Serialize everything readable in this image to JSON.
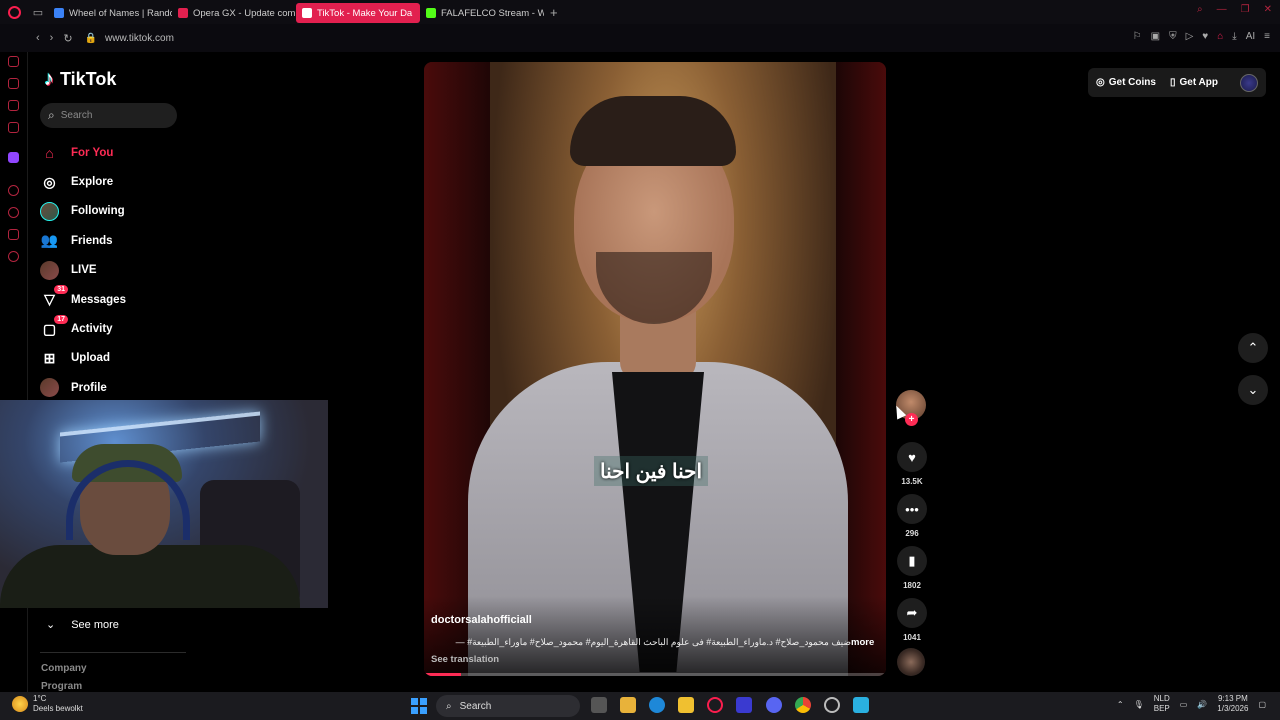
{
  "browser": {
    "tabs": [
      {
        "label": "Wheel of Names | Random",
        "color": "#3b82f6"
      },
      {
        "label": "Opera GX - Update comp",
        "color": "#e2204f"
      },
      {
        "label": "TikTok - Make Your Da",
        "color": "#ffffff",
        "active": true
      },
      {
        "label": "FALAFELCO Stream - Wat",
        "color": "#53fc18"
      }
    ],
    "url": "www.tiktok.com",
    "ai_label": "AI"
  },
  "tiktok": {
    "logo_text": "TikTok",
    "search_placeholder": "Search",
    "nav": [
      {
        "label": "For You",
        "icon": "home-icon",
        "glyph": "⌂",
        "active": true
      },
      {
        "label": "Explore",
        "icon": "compass-icon",
        "glyph": "◎"
      },
      {
        "label": "Following",
        "icon": "following-avatar",
        "glyph": ""
      },
      {
        "label": "Friends",
        "icon": "friends-icon",
        "glyph": "👥"
      },
      {
        "label": "LIVE",
        "icon": "live-avatar",
        "glyph": ""
      },
      {
        "label": "Messages",
        "icon": "messages-icon",
        "glyph": "▽",
        "badge": "31"
      },
      {
        "label": "Activity",
        "icon": "activity-icon",
        "glyph": "▢",
        "badge": "17"
      },
      {
        "label": "Upload",
        "icon": "upload-icon",
        "glyph": "⊞"
      },
      {
        "label": "Profile",
        "icon": "profile-avatar",
        "glyph": ""
      }
    ],
    "see_more": "See more",
    "footer": [
      "Company",
      "Program"
    ],
    "get_coins": "Get Coins",
    "get_app": "Get App"
  },
  "video": {
    "caption_overlay": "احنا فين احنا",
    "author": "doctorsalahofficiall",
    "description": "ضيف محمود_صلاح# د.ماوراء_الطبيعة# فى علوم الباحث القاهرة_اليوم# محمود_صلاح# ماوراء_الطبيعة# —",
    "more": "more",
    "see_translation": "See translation",
    "progress": 0.08,
    "likes": "13.5K",
    "comments": "296",
    "saves": "1802",
    "shares": "1041"
  },
  "taskbar": {
    "weather_temp": "1°C",
    "weather_desc": "Deels bewolkt",
    "search": "Search",
    "lang_top": "NLD",
    "lang_bottom": "BEP",
    "time": "9:13 PM",
    "date": "1/3/2026"
  }
}
